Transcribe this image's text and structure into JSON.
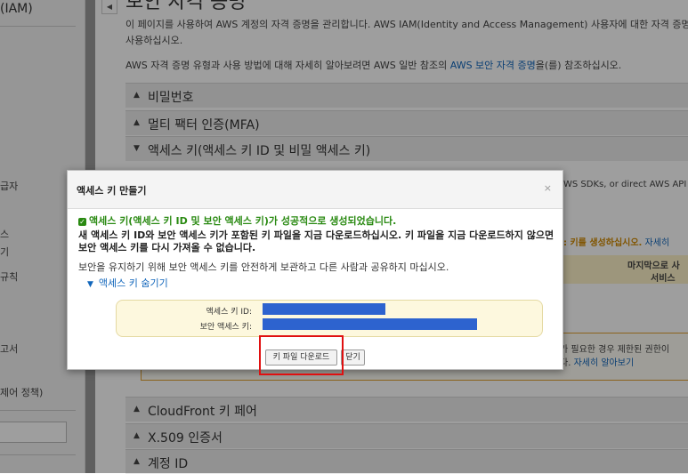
{
  "sidebar": {
    "title": "(IAM)",
    "items": [
      "급자",
      "스",
      "기",
      "규칙",
      "고서",
      "제어 정책)"
    ]
  },
  "main": {
    "page_title": "보안 자격 증명",
    "intro": "이 페이지를 사용하여 AWS 계정의 자격 증명을 관리합니다. AWS IAM(Identity and Access Management) 사용자에 대한 자격 증명을 관리하려면 IAM 콘솔을 사용하십시오.",
    "intro_line1": "이 페이지를 사용하여 AWS 계정의 자격 증명을 관리합니다. AWS IAM(Identity and Access Management) 사용자에 대한 자격 증명",
    "intro_line2": "사용하십시오.",
    "info_prefix": "AWS 자격 증명 유형과 사용 방법에 대해 자세히 알아보려면 AWS 일반 참조의 ",
    "info_link": "AWS 보안 자격 증명",
    "info_suffix": "을(를) 참조하십시오.",
    "sections": [
      {
        "label": "비밀번호",
        "expanded": false
      },
      {
        "label": "멀티 팩터 인증(MFA)",
        "expanded": false
      },
      {
        "label": "액세스 키(액세스 키 ID 및 비밀 액세스 키)",
        "expanded": true
      },
      {
        "label": "CloudFront 키 페어",
        "expanded": false
      },
      {
        "label": "X.509 인증서",
        "expanded": false
      },
      {
        "label": "계정 ID",
        "expanded": false
      }
    ],
    "bg_right1": "WS SDKs, or direct AWS API c",
    "bg_right2_bold": ": 키를 생성하십시오.",
    "bg_right2_link": " 자세히",
    "bg_table_h1": "마지막으로 사",
    "bg_table_h2": "서비스",
    "bg_warn1": "가 필요한 경우 제한된 권한이",
    "bg_warn2_prefix": "다. ",
    "bg_warn2_link": "자세히 알아보기"
  },
  "modal": {
    "title": "액세스 키 만들기",
    "close": "×",
    "success": "액세스 키(액세스 키 ID 및 보안 액세스 키)가 성공적으로 생성되었습니다.",
    "message": "새 액세스 키 ID와 보안 액세스 키가 포함된 키 파일을 지금 다운로드하십시오. 키 파일을 지금 다운로드하지 않으면 보안 액세스 키를 다시 가져올 수 없습니다.",
    "message2": "보안을 유지하기 위해 보안 액세스 키를 안전하게 보관하고 다른 사람과 공유하지 마십시오.",
    "hide_link": "액세스 키 숨기기",
    "key_id_label": "액세스 키 ID:",
    "secret_label": "보안 액세스 키:",
    "download_button": "키 파일 다운로드",
    "close_button": "닫기"
  },
  "colors": {
    "accent_link": "#1166bb",
    "success_green": "#2a8a12",
    "redacted_bar": "#2d63cf",
    "highlight_red": "#e01010"
  }
}
